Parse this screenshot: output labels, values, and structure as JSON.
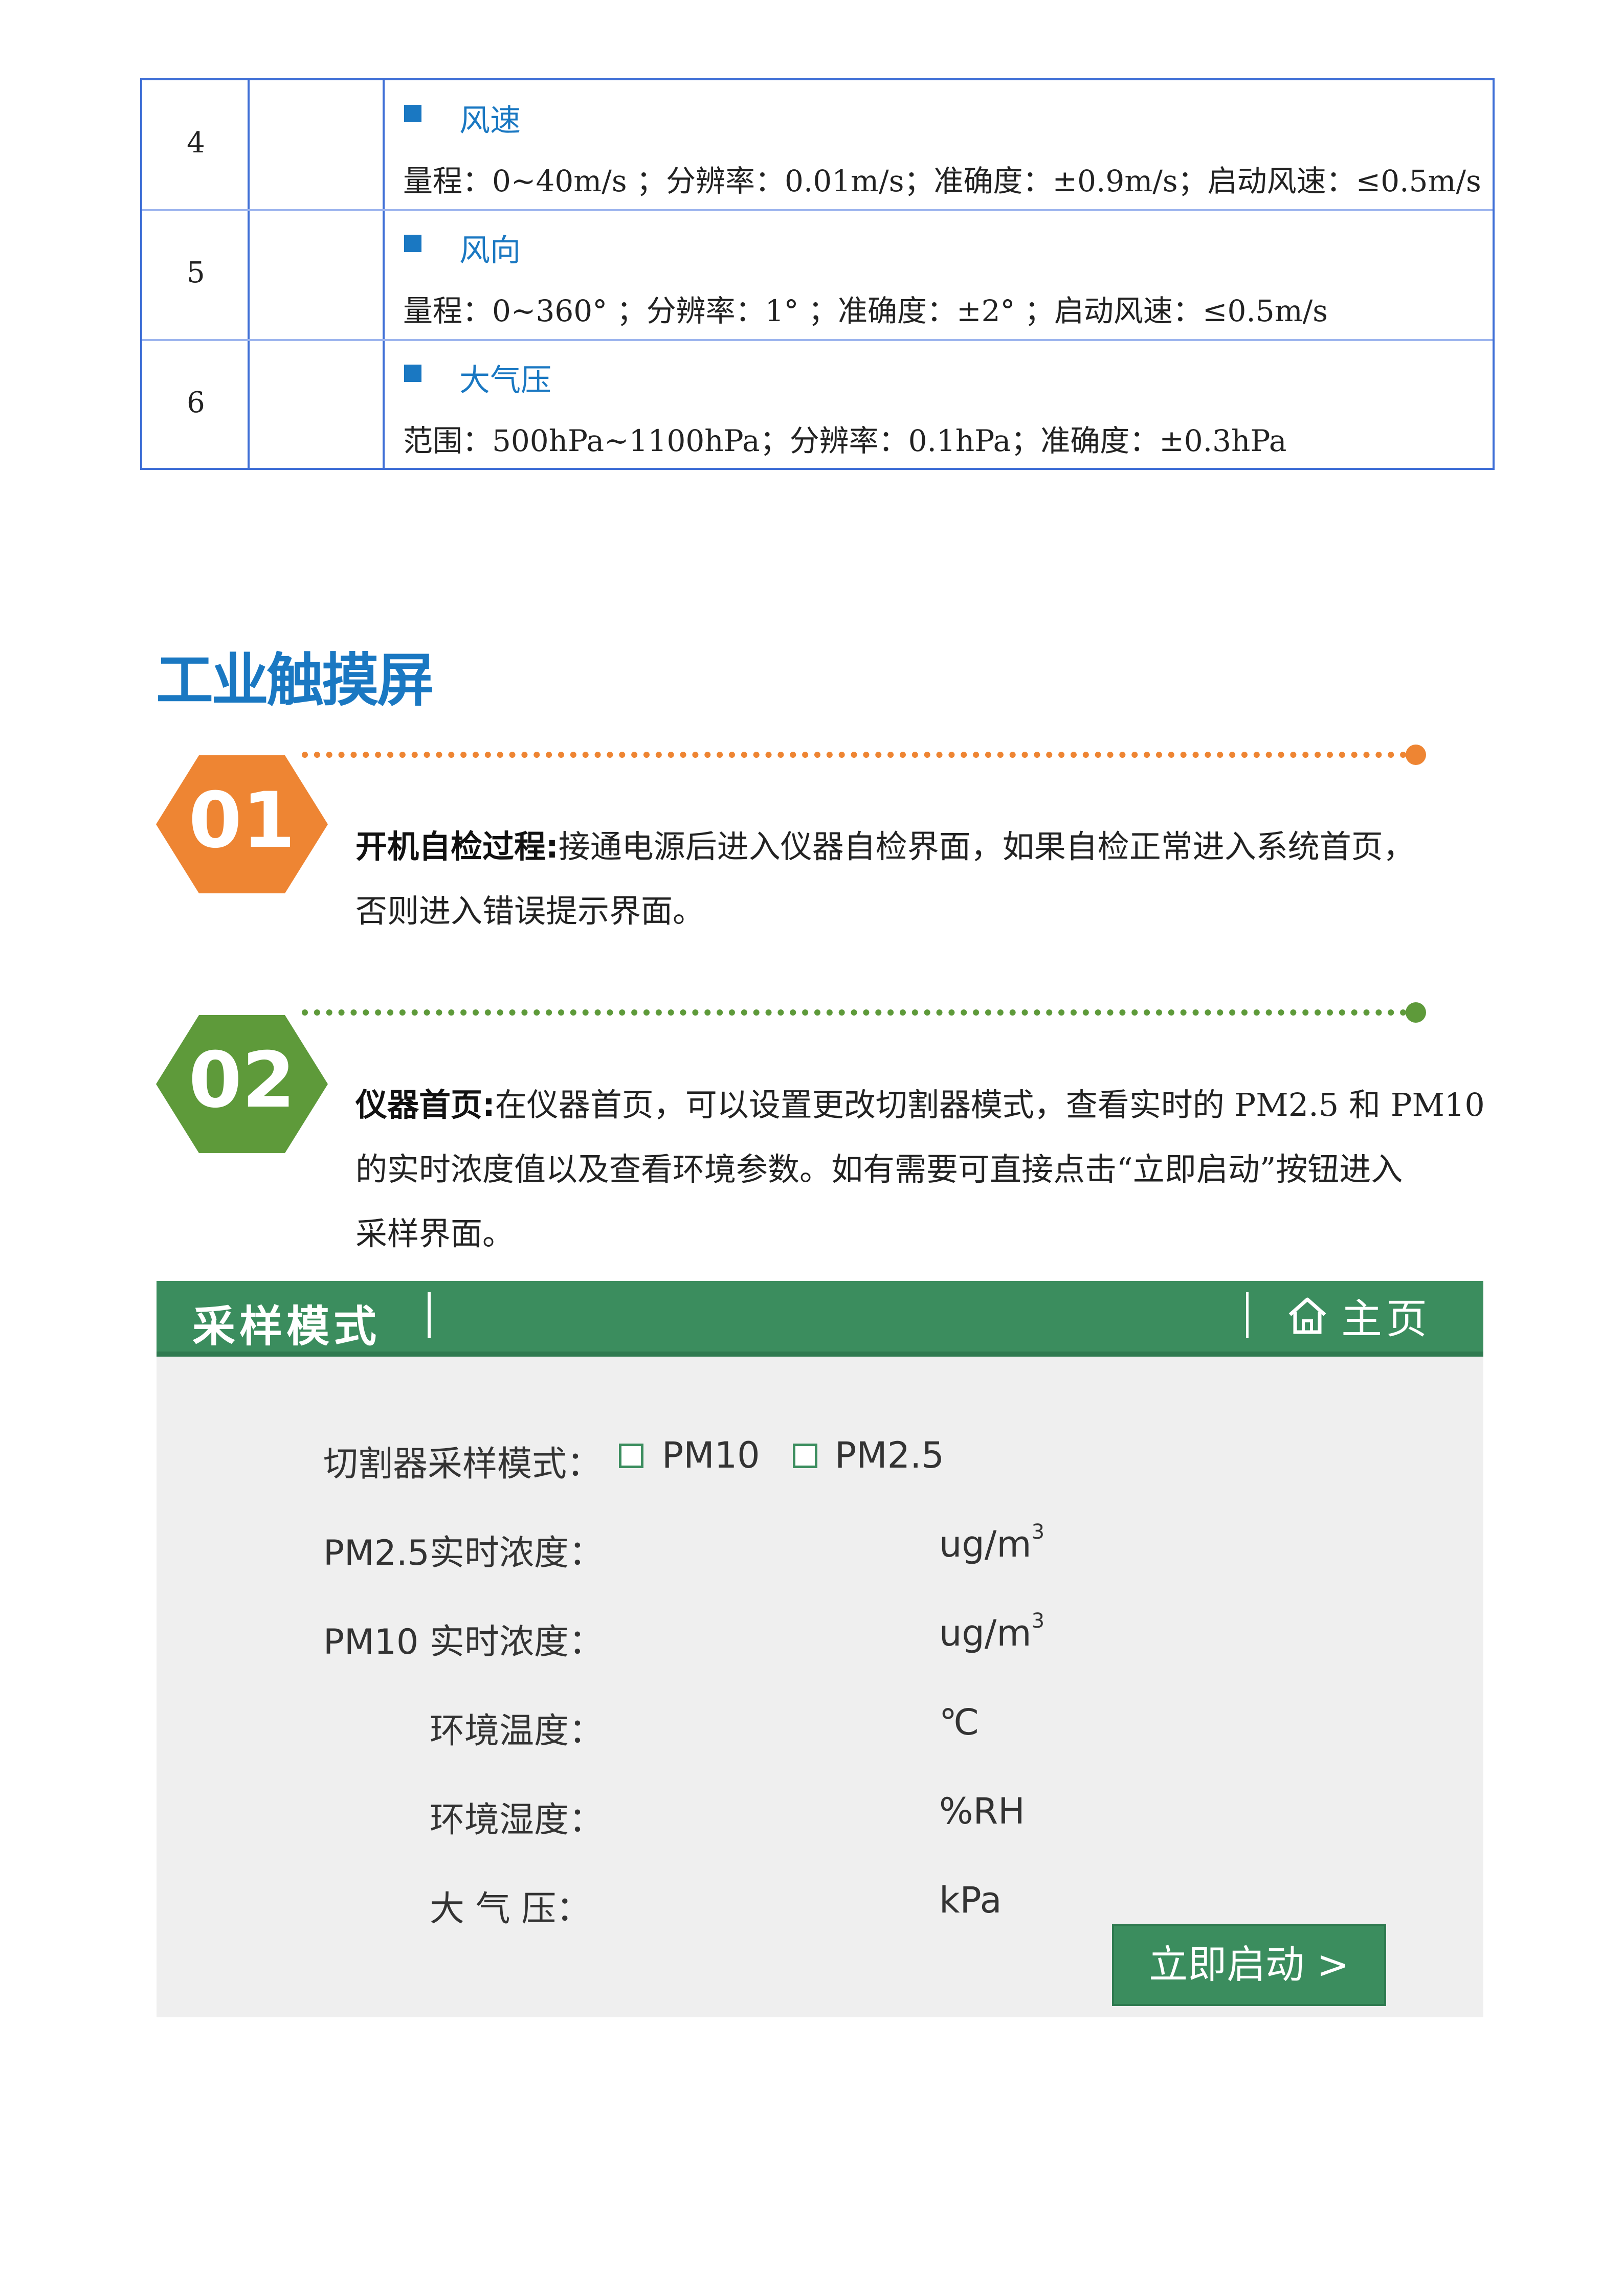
{
  "spec_table": {
    "rows": [
      {
        "num": "4",
        "name": "风速",
        "spec": "量程：0~40m/s ；分辨率：0.01m/s；准确度：±0.9m/s；启动风速：≤0.5m/s"
      },
      {
        "num": "5",
        "name": "风向",
        "spec": "量程：0~360° ；分辨率：1° ；准确度：±2° ；启动风速：≤0.5m/s"
      },
      {
        "num": "6",
        "name": "大气压",
        "spec": "范围：500hPa~1100hPa；分辨率：0.1hPa；准确度：±0.3hPa"
      }
    ]
  },
  "section": {
    "title": "工业触摸屏"
  },
  "steps": [
    {
      "num": "01",
      "heading": "开机自检过程:",
      "lines": [
        "接通电源后进入仪器自检界面，如果自检正常进入系统首页，",
        "否则进入错误提示界面。"
      ],
      "color": "#ee8533"
    },
    {
      "num": "02",
      "heading": "仪器首页:",
      "lines": [
        "在仪器首页，可以设置更改切割器模式，查看实时的 PM2.5 和 PM10",
        "的实时浓度值以及查看环境参数。如有需要可直接点击“立即启动”按钮进入",
        "采样界面。"
      ],
      "color": "#5e9a3a"
    }
  ],
  "ui": {
    "title": "采样模式",
    "home": "主页",
    "cutter_label": "切割器采样模式：",
    "option_pm10": "PM10",
    "option_pm25": "PM2.5",
    "fields": [
      {
        "label": "PM2.5实时浓度：",
        "unit": "ug/m",
        "sup": "3"
      },
      {
        "label": "PM10 实时浓度：",
        "unit": "ug/m",
        "sup": "3"
      },
      {
        "label": "环境温度：",
        "unit": "℃",
        "sup": ""
      },
      {
        "label": "环境湿度：",
        "unit": "%RH",
        "sup": ""
      },
      {
        "label": "大 气 压：",
        "unit": "kPa",
        "sup": ""
      }
    ],
    "start_button": "立即启动 >",
    "bar_color": "#3b8d5e"
  }
}
